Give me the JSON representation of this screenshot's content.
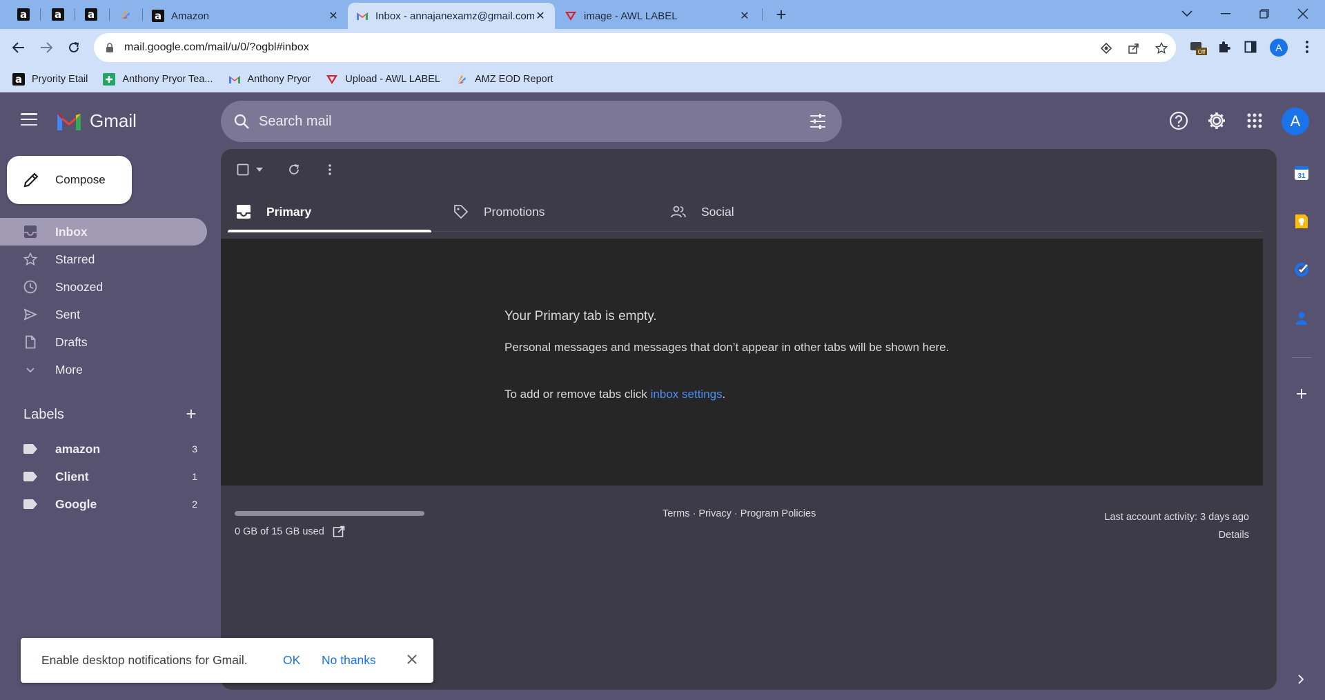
{
  "browser": {
    "pinned_tabs": [
      "a",
      "a",
      "a"
    ],
    "tabs": [
      {
        "title": "Amazon"
      },
      {
        "title": "Inbox - annajanexamz@gmail.com"
      },
      {
        "title": "image - AWL LABEL"
      }
    ],
    "url": "mail.google.com/mail/u/0/?ogbl#inbox",
    "extension_badge": "Off",
    "profile_initial": "A",
    "bookmarks": [
      {
        "label": "Pryority Etail"
      },
      {
        "label": "Anthony Pryor Tea..."
      },
      {
        "label": "Anthony Pryor"
      },
      {
        "label": "Upload - AWL LABEL"
      },
      {
        "label": "AMZ EOD Report"
      }
    ]
  },
  "gmail": {
    "logo_text": "Gmail",
    "search_placeholder": "Search mail",
    "avatar_initial": "A",
    "compose_label": "Compose",
    "nav": [
      {
        "label": "Inbox"
      },
      {
        "label": "Starred"
      },
      {
        "label": "Snoozed"
      },
      {
        "label": "Sent"
      },
      {
        "label": "Drafts"
      },
      {
        "label": "More"
      }
    ],
    "labels_heading": "Labels",
    "labels": [
      {
        "name": "amazon",
        "count": "3"
      },
      {
        "name": "Client",
        "count": "1"
      },
      {
        "name": "Google",
        "count": "2"
      }
    ],
    "tabs": [
      {
        "label": "Primary"
      },
      {
        "label": "Promotions"
      },
      {
        "label": "Social"
      }
    ],
    "empty": {
      "title": "Your Primary tab is empty.",
      "description": "Personal messages and messages that don’t appear in other tabs will be shown here.",
      "link_prefix": "To add or remove tabs click ",
      "link_text": "inbox settings",
      "link_suffix": "."
    },
    "storage": {
      "text": "0 GB of 15 GB used",
      "used_fraction": 0.0
    },
    "footer": {
      "links": "Terms · Privacy · Program Policies"
    },
    "activity": {
      "line1": "Last account activity: 3 days ago",
      "details": "Details"
    },
    "calendar_day": "31"
  },
  "notification": {
    "message": "Enable desktop notifications for Gmail.",
    "ok": "OK",
    "no_thanks": "No thanks"
  }
}
